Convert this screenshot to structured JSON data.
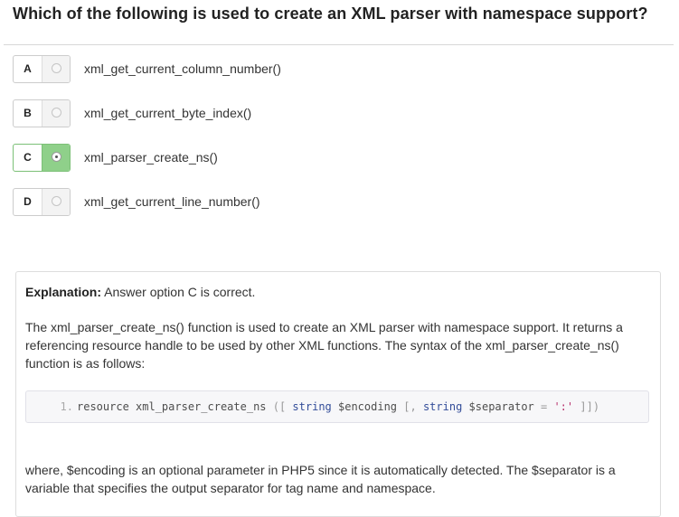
{
  "question": {
    "text": "Which of the following is used to create an XML parser with namespace support?"
  },
  "options": [
    {
      "letter": "A",
      "text": "xml_get_current_column_number()",
      "selected": false
    },
    {
      "letter": "B",
      "text": "xml_get_current_byte_index()",
      "selected": false
    },
    {
      "letter": "C",
      "text": "xml_parser_create_ns()",
      "selected": true
    },
    {
      "letter": "D",
      "text": "xml_get_current_line_number()",
      "selected": false
    }
  ],
  "explanation": {
    "label": "Explanation:",
    "answer": "Answer option C is correct.",
    "paragraph1": "The xml_parser_create_ns() function is used to create an XML parser with namespace support. It returns a referencing resource handle to be used by other XML functions. The syntax of the xml_parser_create_ns() function is as follows:",
    "code": {
      "line_number": "1.",
      "tokens": {
        "t1": "resource xml_parser_create_ns ",
        "t2": "([",
        "t3": " string",
        "t4": " $encoding ",
        "t5": "[,",
        "t6": " string",
        "t7": " $separator ",
        "t8": "=",
        "t9": " ':'",
        "t10": " ]])"
      }
    },
    "paragraph2": "where, $encoding is an optional parameter in PHP5 since it is automatically detected. The $separator is a variable that specifies the output separator for tag name and namespace."
  },
  "colors": {
    "selected_radio_bg": "#8fd08a",
    "question_text": "#222222",
    "body_text": "#333333"
  }
}
